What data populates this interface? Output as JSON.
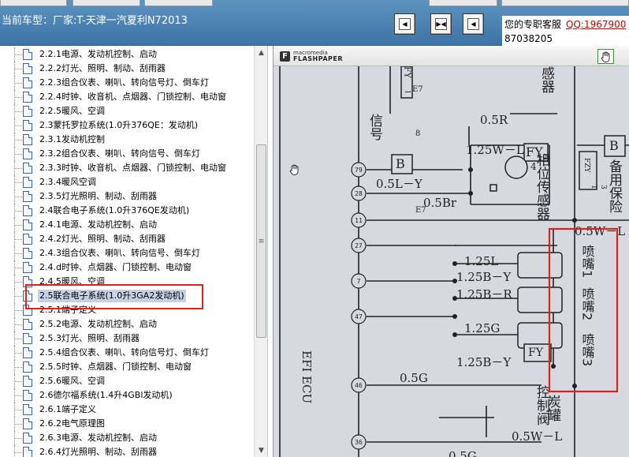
{
  "header": {
    "car_label": "当前车型：厂家:T-天津一汽夏利N72013",
    "service_label": "您的专职客服",
    "qq_label": "QQ:1967900",
    "phone": "87038205"
  },
  "nav_icons": [
    "first-page-icon",
    "fit-page-icon",
    "next-page-icon"
  ],
  "tree": {
    "items": [
      {
        "label": "2.2.1电源、发动机控制、启动"
      },
      {
        "label": "2.2.2灯光、照明、制动、刮雨器"
      },
      {
        "label": "2.2.3组合仪表、喇叭、转向信号灯、倒车灯"
      },
      {
        "label": "2.2.4时钟、收音机、点烟器、门锁控制、电动窗"
      },
      {
        "label": "2.2.5暖风、空调"
      },
      {
        "label": "2.3蒙托罗拉系统(1.0升376QE：发动机)"
      },
      {
        "label": "2.3.1发动机控制"
      },
      {
        "label": "2.3.2组合仪表、喇叭、转向信号、倒车灯"
      },
      {
        "label": "2.3.3时钟、收音机、点烟器、门锁控制、电动窗"
      },
      {
        "label": "2.3.4暖风空调"
      },
      {
        "label": "2.3.5灯光照明、制动、刮雨器"
      },
      {
        "label": "2.4联合电子系统(1.0升376QE发动机)"
      },
      {
        "label": "2.4.1电源、发动机控制、启动"
      },
      {
        "label": "2.4.2灯光、照明、制动、刮雨器"
      },
      {
        "label": "2.4.3组合仪表、喇叭、转向信号、倒车灯"
      },
      {
        "label": "2.4.d时钟、点烟器、门锁控制、电动窗"
      },
      {
        "label": "2.4.5暖风、空调"
      },
      {
        "label": "2.5联合电子系统(1.0升3GA2发动机)"
      },
      {
        "label": "2.5.1端子定义"
      },
      {
        "label": "2.5.2电源、发动机控制、启动"
      },
      {
        "label": "2.5.3灯光、照明、刮雨器"
      },
      {
        "label": "2.5.4组合仪表、喇叭、转向信号灯、倒车灯"
      },
      {
        "label": "2.5.5时钟、点烟器、门锁控制、电动窗"
      },
      {
        "label": "2.5.6暖风、空调"
      },
      {
        "label": "2.6德尔福系统(1.4升4GBl发动机)"
      },
      {
        "label": "2.6.1端子定义"
      },
      {
        "label": "2.6.2电气原理图"
      },
      {
        "label": "2.6.3电源、发动机控制、启动"
      },
      {
        "label": "2.6.4灯光照明、制动、刮雨器"
      }
    ],
    "selected_index": 17
  },
  "viewer": {
    "brand_small": "macromedia",
    "brand_large": "FLASHPAPER",
    "hand_icon": "hand-icon"
  },
  "diagram": {
    "wire_labels": {
      "w1": "0.5R",
      "w2": "1.25W－L",
      "w3": "0.5L－Y",
      "w4": "0.5Br",
      "w5": "1.25L",
      "w6": "1.25B－Y",
      "w7": "1.25B－R",
      "w8": "1.25G",
      "w9": "1.25B－Y",
      "w10": "0.5G",
      "w11": "0.5W－L",
      "w12": "0.5G",
      "w13": "0.5W－L"
    },
    "pins": [
      "79",
      "28",
      "11",
      "27",
      "7",
      "47",
      "46",
      "36"
    ],
    "components": {
      "fy2": "FY",
      "fy2_sub": "2",
      "fy2_num": "4",
      "b_left": "B",
      "b_right": "B",
      "fzy": "FZY",
      "fzy_sub": "1",
      "fzy_num": "3",
      "e7a": "E7",
      "e7b": "E7",
      "num8": "8",
      "fy_box": "FY",
      "signal": "信号",
      "phase_sensor": "相位传感器",
      "backup_fuse": "备用保险",
      "injector1": "喷嘴1",
      "injector2": "喷嘴2",
      "injector3": "喷嘴3",
      "canister": "炭罐",
      "ctrl_valve": "控制阀",
      "sensor_top": "感器",
      "ecu": "EFI ECU",
      "fy_left": "FY",
      "fy_left_sub": "1"
    }
  }
}
